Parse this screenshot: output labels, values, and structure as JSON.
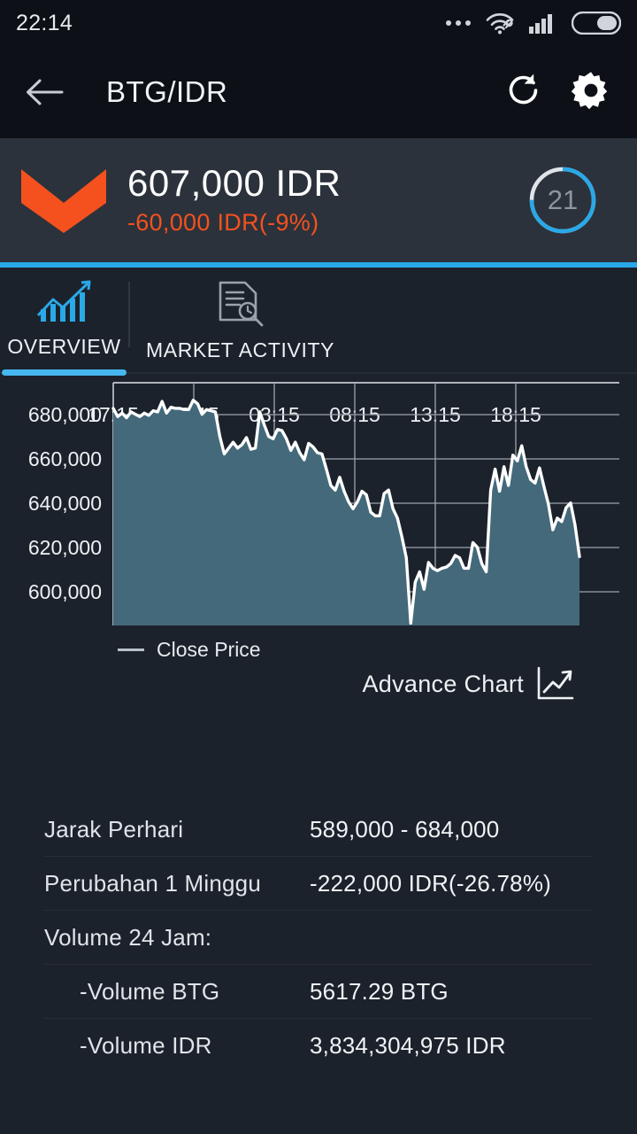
{
  "status_bar": {
    "time": "22:14",
    "icons": [
      "more-dots-icon",
      "wifi-icon",
      "cellular-signal-icon",
      "battery-icon"
    ]
  },
  "app_bar": {
    "back_icon": "arrow-left-icon",
    "title": "BTG/IDR",
    "refresh_icon": "refresh-icon",
    "settings_icon": "gear-icon"
  },
  "price_header": {
    "trend_icon": "chevron-down-icon",
    "trend_color": "#f4511e",
    "price": "607,000 IDR",
    "change": "-60,000 IDR(-9%)",
    "countdown": "21",
    "countdown_color": "#29a8e8",
    "accent_rule_color": "#29a8e8"
  },
  "tabs": [
    {
      "label": "OVERVIEW",
      "icon": "bar-chart-growth-icon",
      "active": true
    },
    {
      "label": "MARKET ACTIVITY",
      "icon": "document-search-icon",
      "active": false
    }
  ],
  "chart_panel": {
    "legend_label": "Close Price",
    "advance_chart_label": "Advance Chart",
    "advance_chart_icon": "trending-up-icon"
  },
  "chart_data": {
    "type": "area",
    "title": "",
    "xlabel": "",
    "ylabel": "",
    "series_name": "Close Price",
    "line_color": "#ffffff",
    "fill_color": "#44697a",
    "grid": true,
    "legend_position": "bottom-left",
    "xtick_labels": [
      "17:15",
      "22:15",
      "03:15",
      "08:15",
      "13:15",
      "18:15"
    ],
    "ytick_labels": [
      "600,000",
      "620,000",
      "640,000",
      "660,000",
      "680,000"
    ],
    "ylim": [
      588000,
      692000
    ],
    "yticks": [
      600000,
      620000,
      640000,
      660000,
      680000
    ],
    "x": [
      0,
      1,
      2,
      3,
      4,
      5,
      6,
      7,
      8,
      9,
      10,
      11,
      12,
      13,
      14,
      15,
      16,
      17,
      18,
      19,
      20,
      21,
      22,
      23,
      24,
      25,
      26,
      27,
      28,
      29,
      30,
      31,
      32,
      33,
      34,
      35,
      36,
      37,
      38,
      39,
      40,
      41,
      42,
      43,
      44,
      45,
      46,
      47,
      48,
      49,
      50,
      51,
      52,
      53,
      54,
      55,
      56,
      57,
      58,
      59,
      60,
      61,
      62,
      63,
      64,
      65,
      66,
      67,
      68,
      69,
      70,
      71,
      72,
      73,
      74,
      75,
      76,
      77,
      78,
      79,
      80,
      81,
      82,
      83,
      84,
      85,
      86,
      87,
      88,
      89,
      90,
      91,
      92,
      93,
      94,
      95,
      96,
      97,
      98,
      99,
      100,
      101,
      102,
      103,
      104,
      105
    ],
    "values": [
      681000,
      677500,
      679000,
      677000,
      679500,
      678500,
      677500,
      679000,
      678000,
      680000,
      679500,
      684000,
      679000,
      681500,
      681000,
      681000,
      680500,
      680500,
      684500,
      683000,
      678500,
      680500,
      680000,
      679500,
      669000,
      661500,
      664000,
      666500,
      664000,
      665500,
      668500,
      663500,
      664000,
      679500,
      674000,
      669000,
      668000,
      672000,
      671500,
      668000,
      663000,
      666500,
      662000,
      659000,
      666000,
      664500,
      662000,
      661500,
      655000,
      648000,
      646000,
      651500,
      645500,
      641000,
      638000,
      641000,
      645500,
      644000,
      636500,
      635000,
      635000,
      644500,
      646000,
      638000,
      634000,
      626000,
      617000,
      589000,
      606500,
      611000,
      603500,
      615000,
      612500,
      611500,
      612500,
      613000,
      614500,
      618000,
      617000,
      612500,
      612500,
      623500,
      621500,
      614500,
      611000,
      646000,
      655000,
      645500,
      656000,
      648000,
      661000,
      658500,
      665000,
      656000,
      650500,
      649000,
      655500,
      647500,
      640000,
      629000,
      634000,
      632500,
      638500,
      640500,
      631000,
      617500
    ],
    "min_value": 589000,
    "max_value": 684500,
    "last_value": 607000
  },
  "details": [
    {
      "key": "Jarak Perhari",
      "value": "589,000 - 684,000",
      "indent": false
    },
    {
      "key": "Perubahan 1 Minggu",
      "value": "-222,000 IDR(-26.78%)",
      "indent": false
    },
    {
      "key": "Volume 24 Jam:",
      "value": "",
      "indent": false
    },
    {
      "key": "-Volume BTG",
      "value": "5617.29 BTG",
      "indent": true
    },
    {
      "key": "-Volume IDR",
      "value": "3,834,304,975 IDR",
      "indent": true
    }
  ]
}
